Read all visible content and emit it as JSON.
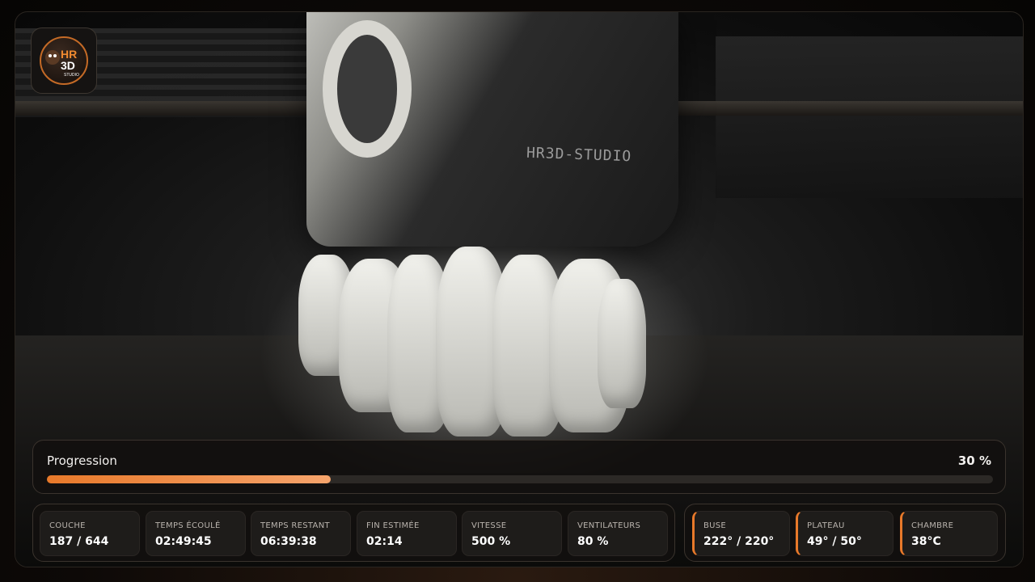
{
  "camera": {
    "printhead_label": "HR3D-STUDIO"
  },
  "logo": {
    "line1": "HR",
    "line2": "3D",
    "line3": "STUDIO"
  },
  "progress": {
    "label": "Progression",
    "percent_text": "30 %",
    "value": 0.3
  },
  "stats": [
    {
      "key": "COUCHE",
      "value": "187 / 644"
    },
    {
      "key": "TEMPS ÉCOULÉ",
      "value": "02:49:45"
    },
    {
      "key": "TEMPS RESTANT",
      "value": "06:39:38"
    },
    {
      "key": "FIN ESTIMÉE",
      "value": "02:14"
    },
    {
      "key": "VITESSE",
      "value": "500 %"
    },
    {
      "key": "VENTILATEURS",
      "value": "80 %"
    }
  ],
  "temps": [
    {
      "key": "BUSE",
      "value": "222° / 220°"
    },
    {
      "key": "PLATEAU",
      "value": "49° / 50°"
    },
    {
      "key": "CHAMBRE",
      "value": "38°C"
    }
  ],
  "colors": {
    "accent": "#e8792a",
    "accent_light": "#f6a46c"
  }
}
